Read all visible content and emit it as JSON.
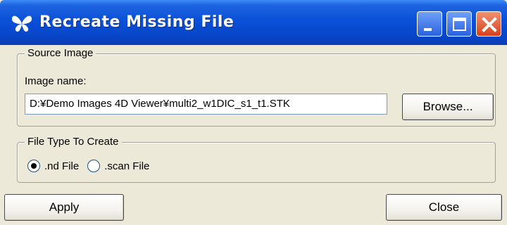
{
  "window": {
    "title": "Recreate Missing File",
    "app_icon": "butterfly-icon",
    "controls": {
      "minimize": "minimize-icon",
      "maximize": "maximize-icon",
      "close": "close-icon"
    }
  },
  "source_image": {
    "group_label": "Source Image",
    "field_label": "Image name:",
    "value": "D:¥Demo Images 4D Viewer¥multi2_w1DIC_s1_t1.STK",
    "browse_label": "Browse..."
  },
  "file_type": {
    "group_label": "File Type To Create",
    "options": [
      {
        "label": ".nd File",
        "selected": true
      },
      {
        "label": ".scan File",
        "selected": false
      }
    ]
  },
  "footer": {
    "apply_label": "Apply",
    "close_label": "Close"
  }
}
